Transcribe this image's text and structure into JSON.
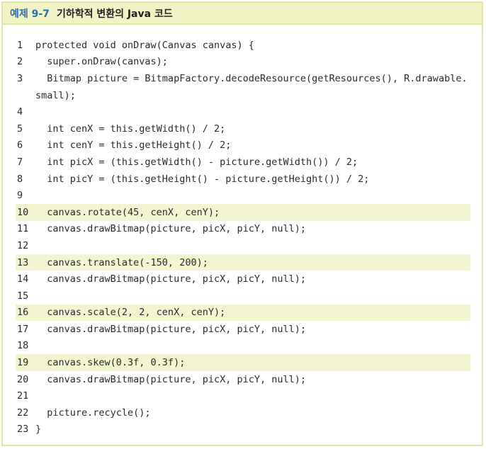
{
  "header": {
    "label": "예제 9-7",
    "title": "기하학적 변환의 Java 코드"
  },
  "code_lines": [
    {
      "num": "1",
      "text": "protected void onDraw(Canvas canvas) {",
      "highlight": false
    },
    {
      "num": "2",
      "text": "  super.onDraw(canvas);",
      "highlight": false
    },
    {
      "num": "3",
      "text": "  Bitmap picture = BitmapFactory.decodeResource(getResources(), R.drawable.",
      "highlight": false
    },
    {
      "num": "",
      "text": "small);",
      "highlight": false
    },
    {
      "num": "4",
      "text": "",
      "highlight": false
    },
    {
      "num": "5",
      "text": "  int cenX = this.getWidth() / 2;",
      "highlight": false
    },
    {
      "num": "6",
      "text": "  int cenY = this.getHeight() / 2;",
      "highlight": false
    },
    {
      "num": "7",
      "text": "  int picX = (this.getWidth() - picture.getWidth()) / 2;",
      "highlight": false
    },
    {
      "num": "8",
      "text": "  int picY = (this.getHeight() - picture.getHeight()) / 2;",
      "highlight": false
    },
    {
      "num": "9",
      "text": "",
      "highlight": false
    },
    {
      "num": "10",
      "text": "  canvas.rotate(45, cenX, cenY);",
      "highlight": true
    },
    {
      "num": "11",
      "text": "  canvas.drawBitmap(picture, picX, picY, null);",
      "highlight": false
    },
    {
      "num": "12",
      "text": "",
      "highlight": false
    },
    {
      "num": "13",
      "text": "  canvas.translate(-150, 200);",
      "highlight": true
    },
    {
      "num": "14",
      "text": "  canvas.drawBitmap(picture, picX, picY, null);",
      "highlight": false
    },
    {
      "num": "15",
      "text": "",
      "highlight": false
    },
    {
      "num": "16",
      "text": "  canvas.scale(2, 2, cenX, cenY);",
      "highlight": true
    },
    {
      "num": "17",
      "text": "  canvas.drawBitmap(picture, picX, picY, null);",
      "highlight": false
    },
    {
      "num": "18",
      "text": "",
      "highlight": false
    },
    {
      "num": "19",
      "text": "  canvas.skew(0.3f, 0.3f);",
      "highlight": true
    },
    {
      "num": "20",
      "text": "  canvas.drawBitmap(picture, picX, picY, null);",
      "highlight": false
    },
    {
      "num": "21",
      "text": "",
      "highlight": false
    },
    {
      "num": "22",
      "text": "  picture.recycle();",
      "highlight": false
    },
    {
      "num": "23",
      "text": "}",
      "highlight": false
    }
  ]
}
